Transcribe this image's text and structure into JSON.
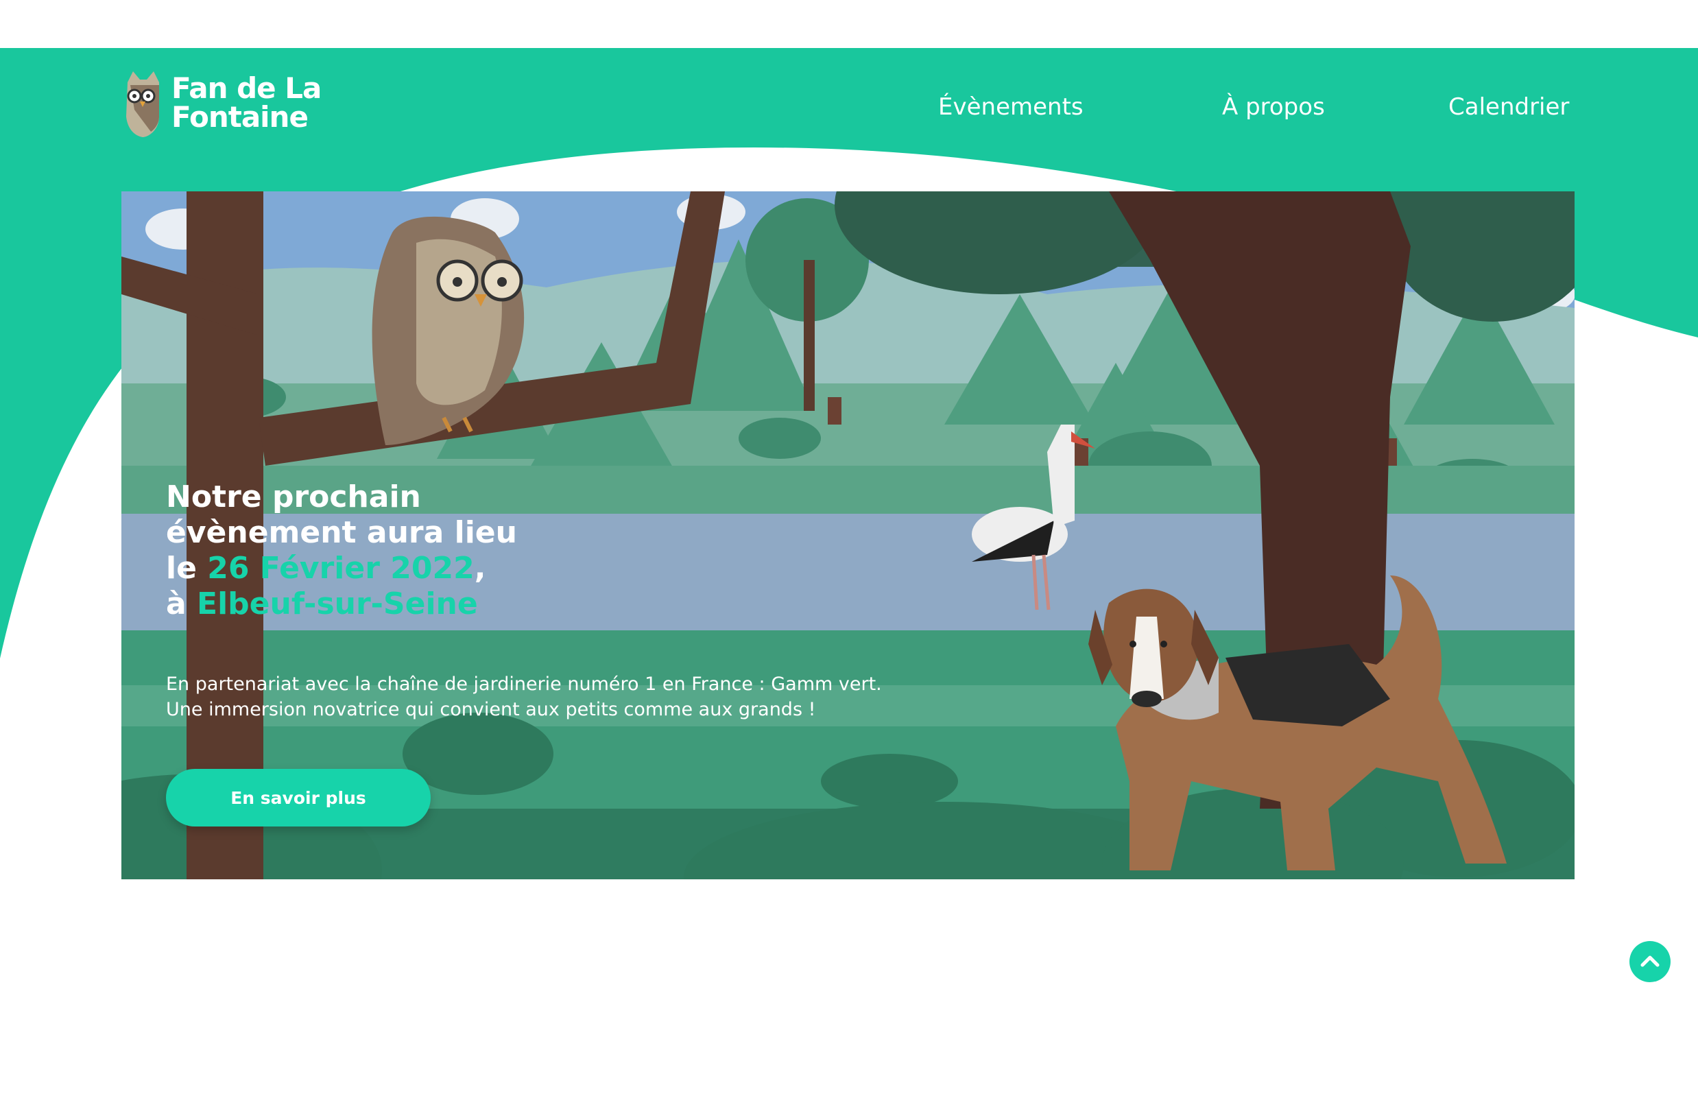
{
  "brand": {
    "line1": "Fan de La",
    "line2": "Fontaine"
  },
  "nav": {
    "events": "Évènements",
    "about": "À propos",
    "calendar": "Calendrier"
  },
  "hero": {
    "title_line1": "Notre prochain",
    "title_line2": "évènement aura lieu",
    "title_prefix3": "le ",
    "date": "26 Février 2022",
    "title_suffix3": ",",
    "title_prefix4": "à ",
    "place": "Elbeuf-sur-Seine",
    "desc_line1": "En partenariat avec la chaîne de jardinerie numéro 1 en France : Gamm vert.",
    "desc_line2": "Une immersion novatrice qui convient aux petits comme aux grands !",
    "cta": "En savoir plus"
  },
  "colors": {
    "accent": "#17d3aa",
    "brand_green": "#19c79d",
    "white": "#ffffff"
  },
  "icons": {
    "logo": "owl-icon",
    "scroll_top": "chevron-up-icon"
  }
}
